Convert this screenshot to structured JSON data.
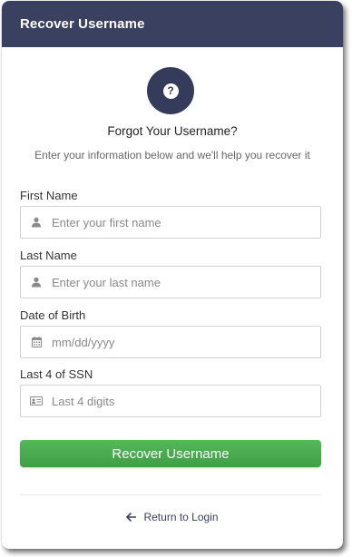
{
  "header": {
    "title": "Recover Username"
  },
  "intro": {
    "help_icon": "question-circle-icon",
    "heading": "Forgot Your Username?",
    "subheading": "Enter your information below and we'll help you recover it"
  },
  "form": {
    "first_name": {
      "label": "First Name",
      "placeholder": "Enter your first name",
      "icon": "user-icon"
    },
    "last_name": {
      "label": "Last Name",
      "placeholder": "Enter your last name",
      "icon": "user-icon"
    },
    "dob": {
      "label": "Date of Birth",
      "placeholder": "mm/dd/yyyy",
      "icon": "calendar-icon"
    },
    "ssn": {
      "label": "Last 4 of SSN",
      "placeholder": "Last 4 digits",
      "icon": "id-card-icon"
    },
    "submit_label": "Recover Username"
  },
  "footer": {
    "back_label": "Return to Login",
    "back_icon": "arrow-left-icon"
  },
  "colors": {
    "header": "#3a4160",
    "button": "#4caf50",
    "link": "#3a4160"
  }
}
